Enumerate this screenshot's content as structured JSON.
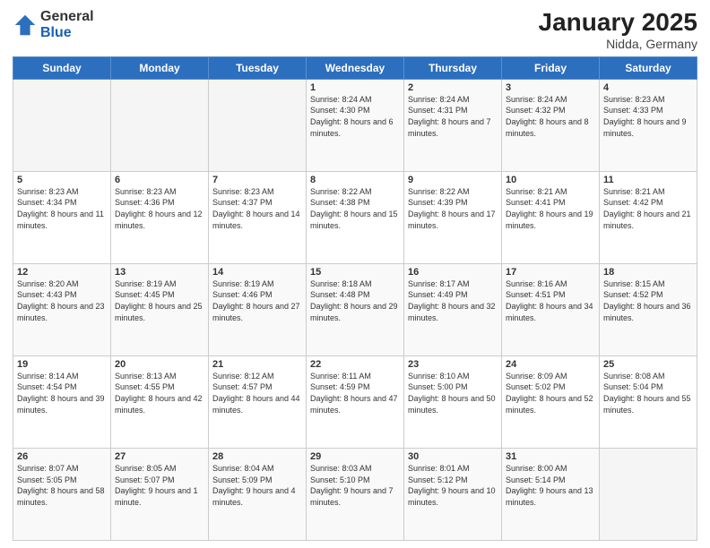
{
  "header": {
    "logo": {
      "general": "General",
      "blue": "Blue"
    },
    "title": "January 2025",
    "location": "Nidda, Germany"
  },
  "weekdays": [
    "Sunday",
    "Monday",
    "Tuesday",
    "Wednesday",
    "Thursday",
    "Friday",
    "Saturday"
  ],
  "weeks": [
    [
      {
        "day": "",
        "info": ""
      },
      {
        "day": "",
        "info": ""
      },
      {
        "day": "",
        "info": ""
      },
      {
        "day": "1",
        "info": "Sunrise: 8:24 AM\nSunset: 4:30 PM\nDaylight: 8 hours and 6 minutes."
      },
      {
        "day": "2",
        "info": "Sunrise: 8:24 AM\nSunset: 4:31 PM\nDaylight: 8 hours and 7 minutes."
      },
      {
        "day": "3",
        "info": "Sunrise: 8:24 AM\nSunset: 4:32 PM\nDaylight: 8 hours and 8 minutes."
      },
      {
        "day": "4",
        "info": "Sunrise: 8:23 AM\nSunset: 4:33 PM\nDaylight: 8 hours and 9 minutes."
      }
    ],
    [
      {
        "day": "5",
        "info": "Sunrise: 8:23 AM\nSunset: 4:34 PM\nDaylight: 8 hours and 11 minutes."
      },
      {
        "day": "6",
        "info": "Sunrise: 8:23 AM\nSunset: 4:36 PM\nDaylight: 8 hours and 12 minutes."
      },
      {
        "day": "7",
        "info": "Sunrise: 8:23 AM\nSunset: 4:37 PM\nDaylight: 8 hours and 14 minutes."
      },
      {
        "day": "8",
        "info": "Sunrise: 8:22 AM\nSunset: 4:38 PM\nDaylight: 8 hours and 15 minutes."
      },
      {
        "day": "9",
        "info": "Sunrise: 8:22 AM\nSunset: 4:39 PM\nDaylight: 8 hours and 17 minutes."
      },
      {
        "day": "10",
        "info": "Sunrise: 8:21 AM\nSunset: 4:41 PM\nDaylight: 8 hours and 19 minutes."
      },
      {
        "day": "11",
        "info": "Sunrise: 8:21 AM\nSunset: 4:42 PM\nDaylight: 8 hours and 21 minutes."
      }
    ],
    [
      {
        "day": "12",
        "info": "Sunrise: 8:20 AM\nSunset: 4:43 PM\nDaylight: 8 hours and 23 minutes."
      },
      {
        "day": "13",
        "info": "Sunrise: 8:19 AM\nSunset: 4:45 PM\nDaylight: 8 hours and 25 minutes."
      },
      {
        "day": "14",
        "info": "Sunrise: 8:19 AM\nSunset: 4:46 PM\nDaylight: 8 hours and 27 minutes."
      },
      {
        "day": "15",
        "info": "Sunrise: 8:18 AM\nSunset: 4:48 PM\nDaylight: 8 hours and 29 minutes."
      },
      {
        "day": "16",
        "info": "Sunrise: 8:17 AM\nSunset: 4:49 PM\nDaylight: 8 hours and 32 minutes."
      },
      {
        "day": "17",
        "info": "Sunrise: 8:16 AM\nSunset: 4:51 PM\nDaylight: 8 hours and 34 minutes."
      },
      {
        "day": "18",
        "info": "Sunrise: 8:15 AM\nSunset: 4:52 PM\nDaylight: 8 hours and 36 minutes."
      }
    ],
    [
      {
        "day": "19",
        "info": "Sunrise: 8:14 AM\nSunset: 4:54 PM\nDaylight: 8 hours and 39 minutes."
      },
      {
        "day": "20",
        "info": "Sunrise: 8:13 AM\nSunset: 4:55 PM\nDaylight: 8 hours and 42 minutes."
      },
      {
        "day": "21",
        "info": "Sunrise: 8:12 AM\nSunset: 4:57 PM\nDaylight: 8 hours and 44 minutes."
      },
      {
        "day": "22",
        "info": "Sunrise: 8:11 AM\nSunset: 4:59 PM\nDaylight: 8 hours and 47 minutes."
      },
      {
        "day": "23",
        "info": "Sunrise: 8:10 AM\nSunset: 5:00 PM\nDaylight: 8 hours and 50 minutes."
      },
      {
        "day": "24",
        "info": "Sunrise: 8:09 AM\nSunset: 5:02 PM\nDaylight: 8 hours and 52 minutes."
      },
      {
        "day": "25",
        "info": "Sunrise: 8:08 AM\nSunset: 5:04 PM\nDaylight: 8 hours and 55 minutes."
      }
    ],
    [
      {
        "day": "26",
        "info": "Sunrise: 8:07 AM\nSunset: 5:05 PM\nDaylight: 8 hours and 58 minutes."
      },
      {
        "day": "27",
        "info": "Sunrise: 8:05 AM\nSunset: 5:07 PM\nDaylight: 9 hours and 1 minute."
      },
      {
        "day": "28",
        "info": "Sunrise: 8:04 AM\nSunset: 5:09 PM\nDaylight: 9 hours and 4 minutes."
      },
      {
        "day": "29",
        "info": "Sunrise: 8:03 AM\nSunset: 5:10 PM\nDaylight: 9 hours and 7 minutes."
      },
      {
        "day": "30",
        "info": "Sunrise: 8:01 AM\nSunset: 5:12 PM\nDaylight: 9 hours and 10 minutes."
      },
      {
        "day": "31",
        "info": "Sunrise: 8:00 AM\nSunset: 5:14 PM\nDaylight: 9 hours and 13 minutes."
      },
      {
        "day": "",
        "info": ""
      }
    ]
  ]
}
